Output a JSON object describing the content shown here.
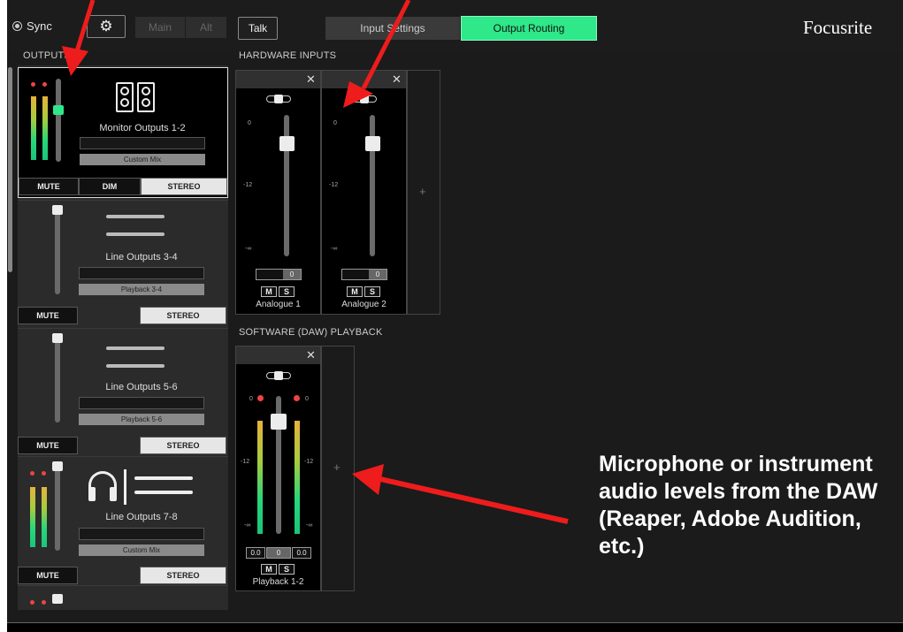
{
  "topbar": {
    "sync_label": "Sync",
    "main_label": "Main",
    "alt_label": "Alt",
    "talk_label": "Talk",
    "tabs": [
      {
        "label": "Input Settings",
        "active": false
      },
      {
        "label": "Output Routing",
        "active": true
      }
    ],
    "brand": "Focusrite"
  },
  "outputs": {
    "title": "OUTPUTS",
    "cards": [
      {
        "name": "Monitor Outputs 1-2",
        "route": "Custom Mix",
        "buttons": [
          "MUTE",
          "DIM",
          "STEREO"
        ]
      },
      {
        "name": "Line Outputs 3-4",
        "route": "Playback 3-4",
        "buttons": [
          "MUTE",
          "STEREO"
        ]
      },
      {
        "name": "Line Outputs 5-6",
        "route": "Playback 5-6",
        "buttons": [
          "MUTE",
          "STEREO"
        ]
      },
      {
        "name": "Line Outputs 7-8",
        "route": "Custom Mix",
        "buttons": [
          "MUTE",
          "STEREO"
        ]
      }
    ]
  },
  "hardware_inputs": {
    "title": "HARDWARE INPUTS",
    "strips": [
      {
        "name": "Analogue 1",
        "pan_value": "0",
        "scale": [
          "0",
          "-12",
          "-∞"
        ],
        "mute": "M",
        "solo": "S",
        "close": "✕"
      },
      {
        "name": "Analogue 2",
        "pan_value": "0",
        "scale": [
          "0",
          "-12",
          "-∞"
        ],
        "mute": "M",
        "solo": "S",
        "close": "✕"
      }
    ],
    "add": "+"
  },
  "software_playback": {
    "title": "SOFTWARE (DAW) PLAYBACK",
    "strips": [
      {
        "name": "Playback 1-2",
        "values": [
          "0.0",
          "0",
          "0.0"
        ],
        "scale": [
          "0",
          "-12",
          "-∞"
        ],
        "mute": "M",
        "solo": "S",
        "close": "✕"
      }
    ],
    "add": "+"
  },
  "annotation": {
    "text": "Microphone or instrument audio levels from the DAW (Reaper, Adobe Audition, etc.)"
  },
  "colors": {
    "accent_green": "#2ee889",
    "arrow_red": "#ee1c1c"
  }
}
